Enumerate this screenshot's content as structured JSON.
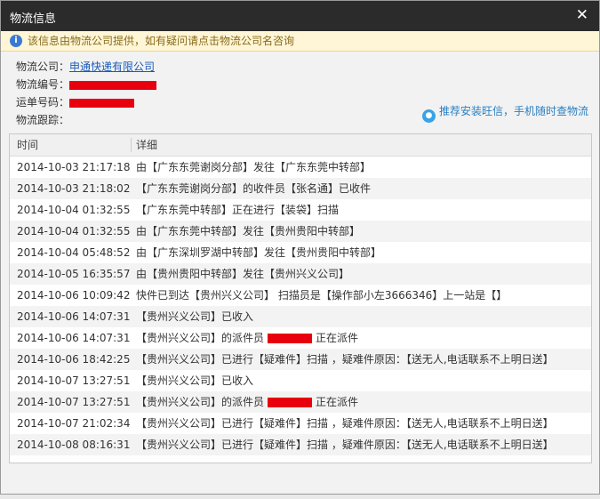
{
  "window": {
    "title": "物流信息",
    "close_symbol": "✕"
  },
  "notice": "该信息由物流公司提供，如有疑问请点击物流公司名咨询",
  "meta": {
    "company_label": "物流公司：",
    "company_name": "申通快递有限公司",
    "tracking_label": "物流编号：",
    "waybill_label": "运单号码：",
    "track_label": "物流跟踪：",
    "wangxin_text": "推荐安装旺信，手机随时查物流"
  },
  "table": {
    "headers": [
      "时间",
      "详细"
    ],
    "rows": [
      {
        "time": "2014-10-03 21:17:18",
        "pre": "由【广东东莞谢岗分部】发往【广东东莞中转部】",
        "post": ""
      },
      {
        "time": "2014-10-03 21:18:02",
        "pre": "【广东东莞谢岗分部】的收件员【张名通】已收件",
        "post": ""
      },
      {
        "time": "2014-10-04 01:32:55",
        "pre": "【广东东莞中转部】正在进行【装袋】扫描",
        "post": ""
      },
      {
        "time": "2014-10-04 01:32:55",
        "pre": "由【广东东莞中转部】发往【贵州贵阳中转部】",
        "post": ""
      },
      {
        "time": "2014-10-04 05:48:52",
        "pre": "由【广东深圳罗湖中转部】发往【贵州贵阳中转部】",
        "post": ""
      },
      {
        "time": "2014-10-05 16:35:57",
        "pre": "由【贵州贵阳中转部】发往【贵州兴义公司】",
        "post": ""
      },
      {
        "time": "2014-10-06 10:09:42",
        "pre": "快件已到达【贵州兴义公司】 扫描员是【操作部小左3666346】上一站是【】",
        "post": ""
      },
      {
        "time": "2014-10-06 14:07:31",
        "pre": "【贵州兴义公司】已收入",
        "post": ""
      },
      {
        "time": "2014-10-06 14:07:31",
        "pre": "【贵州兴义公司】的派件员",
        "post": "正在派件",
        "redacted": true
      },
      {
        "time": "2014-10-06 18:42:25",
        "pre": "【贵州兴义公司】已进行【疑难件】扫描 ，疑难件原因：【送无人,电话联系不上明日送】",
        "post": ""
      },
      {
        "time": "2014-10-07 13:27:51",
        "pre": "【贵州兴义公司】已收入",
        "post": ""
      },
      {
        "time": "2014-10-07 13:27:51",
        "pre": "【贵州兴义公司】的派件员",
        "post": "正在派件",
        "redacted": true
      },
      {
        "time": "2014-10-07 21:02:34",
        "pre": "【贵州兴义公司】已进行【疑难件】扫描 ，疑难件原因：【送无人,电话联系不上明日送】",
        "post": ""
      },
      {
        "time": "2014-10-08 08:16:31",
        "pre": "【贵州兴义公司】已进行【疑难件】扫描 ，疑难件原因：【送无人,电话联系不上明日送】",
        "post": ""
      }
    ]
  },
  "colors": {
    "titlebar": "#2b2b2b",
    "notice_bg": "#fef6d6",
    "redaction": "#e8000e",
    "link": "#1a5bb8"
  },
  "icons": {
    "notice": "info-icon",
    "wangxin": "wangxin-icon",
    "close": "close-icon"
  }
}
